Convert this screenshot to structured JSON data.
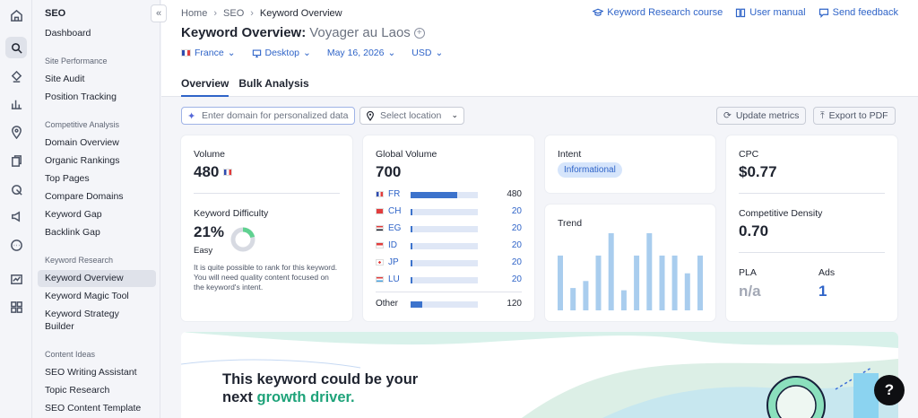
{
  "nav": {
    "title": "SEO",
    "dashboard": "Dashboard",
    "sections": [
      {
        "title": "Site Performance",
        "items": [
          "Site Audit",
          "Position Tracking"
        ]
      },
      {
        "title": "Competitive Analysis",
        "items": [
          "Domain Overview",
          "Organic Rankings",
          "Top Pages",
          "Compare Domains",
          "Keyword Gap",
          "Backlink Gap"
        ]
      },
      {
        "title": "Keyword Research",
        "items": [
          "Keyword Overview",
          "Keyword Magic Tool",
          "Keyword Strategy",
          "Builder"
        ]
      },
      {
        "title": "Content Ideas",
        "items": [
          "SEO Writing Assistant",
          "Topic Research",
          "SEO Content Template"
        ]
      }
    ],
    "collapse_icon": "«"
  },
  "breadcrumb": {
    "home": "Home",
    "seo": "SEO",
    "current": "Keyword Overview"
  },
  "top_links": {
    "course": "Keyword Research course",
    "manual": "User manual",
    "feedback": "Send feedback"
  },
  "page": {
    "title": "Keyword Overview:",
    "keyword": "Voyager au Laos"
  },
  "filters": {
    "country": "France",
    "device": "Desktop",
    "date": "May 16, 2026",
    "currency": "USD"
  },
  "tabs": [
    "Overview",
    "Bulk Analysis"
  ],
  "toolbar": {
    "domain_placeholder": "Enter domain for personalized data",
    "location_placeholder": "Select location",
    "update": "Update metrics",
    "export": "Export to PDF"
  },
  "volume": {
    "label": "Volume",
    "value": "480"
  },
  "difficulty": {
    "label": "Keyword Difficulty",
    "percent": "21%",
    "level": "Easy",
    "fraction": 0.21,
    "description": "It is quite possible to rank for this keyword. You will need quality content focused on the keyword's intent."
  },
  "global_volume": {
    "label": "Global Volume",
    "value": "700",
    "rows": [
      {
        "code": "FR",
        "value": "480",
        "fraction": 0.69
      },
      {
        "code": "CH",
        "value": "20",
        "fraction": 0.03
      },
      {
        "code": "EG",
        "value": "20",
        "fraction": 0.03
      },
      {
        "code": "ID",
        "value": "20",
        "fraction": 0.03
      },
      {
        "code": "JP",
        "value": "20",
        "fraction": 0.03
      },
      {
        "code": "LU",
        "value": "20",
        "fraction": 0.03
      }
    ],
    "other_label": "Other",
    "other_value": "120",
    "other_fraction": 0.17
  },
  "intent": {
    "label": "Intent",
    "value": "Informational"
  },
  "trend": {
    "label": "Trend",
    "values": [
      0.71,
      0.29,
      0.38,
      0.71,
      1.0,
      0.26,
      0.71,
      1.0,
      0.71,
      0.71,
      0.48,
      0.71
    ]
  },
  "cpc": {
    "label": "CPC",
    "value": "$0.77"
  },
  "density": {
    "label": "Competitive Density",
    "value": "0.70"
  },
  "pla": {
    "label": "PLA",
    "value": "n/a"
  },
  "ads": {
    "label": "Ads",
    "value": "1"
  },
  "promo": {
    "line1": "This keyword could be your",
    "line2_prefix": "next ",
    "line2_highlight": "growth driver."
  },
  "help": {
    "label": "?"
  },
  "colors": {
    "accent": "#2f64c8",
    "bar": "#3c73cc",
    "trend": "#a9cdee",
    "green": "#1fa37a"
  }
}
